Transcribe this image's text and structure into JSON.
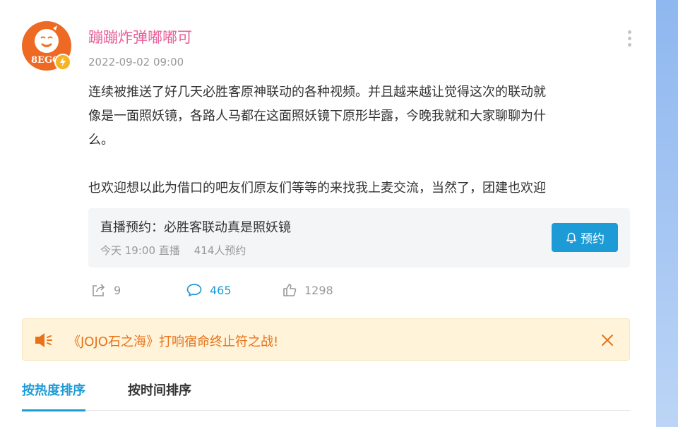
{
  "post": {
    "username": "蹦蹦炸弹嘟嘟可",
    "timestamp": "2022-09-02 09:00",
    "avatar_text": "8EGG",
    "content": {
      "paragraph_1_line_1": "连续被推送了好几天必胜客原神联动的各种视频。并且越来越让觉得这次的联动就",
      "paragraph_1_line_2": "像是一面照妖镜，各路人马都在这面照妖镜下原形毕露，今晚我就和大家聊聊为什",
      "paragraph_1_line_3": "么。",
      "paragraph_2": "也欢迎想以此为借口的吧友们原友们等等的来找我上麦交流，当然了，团建也欢迎"
    },
    "live_card": {
      "title": "直播预约：必胜客联动真是照妖镜",
      "time": "今天 19:00 直播",
      "reservations": "414人预约",
      "reserve_button": "预约"
    },
    "actions": {
      "share_count": "9",
      "comment_count": "465",
      "like_count": "1298"
    }
  },
  "notice": {
    "text": "《JOJO石之海》打响宿命终止符之战!"
  },
  "tabs": [
    {
      "label": "按热度排序",
      "active": true
    },
    {
      "label": "按时间排序",
      "active": false
    }
  ],
  "colors": {
    "accent": "#1d9bd6",
    "username": "#e8609a",
    "notice_text": "#e8721a",
    "notice_bg": "#fff4d9",
    "avatar_bg": "#ee6a24"
  }
}
